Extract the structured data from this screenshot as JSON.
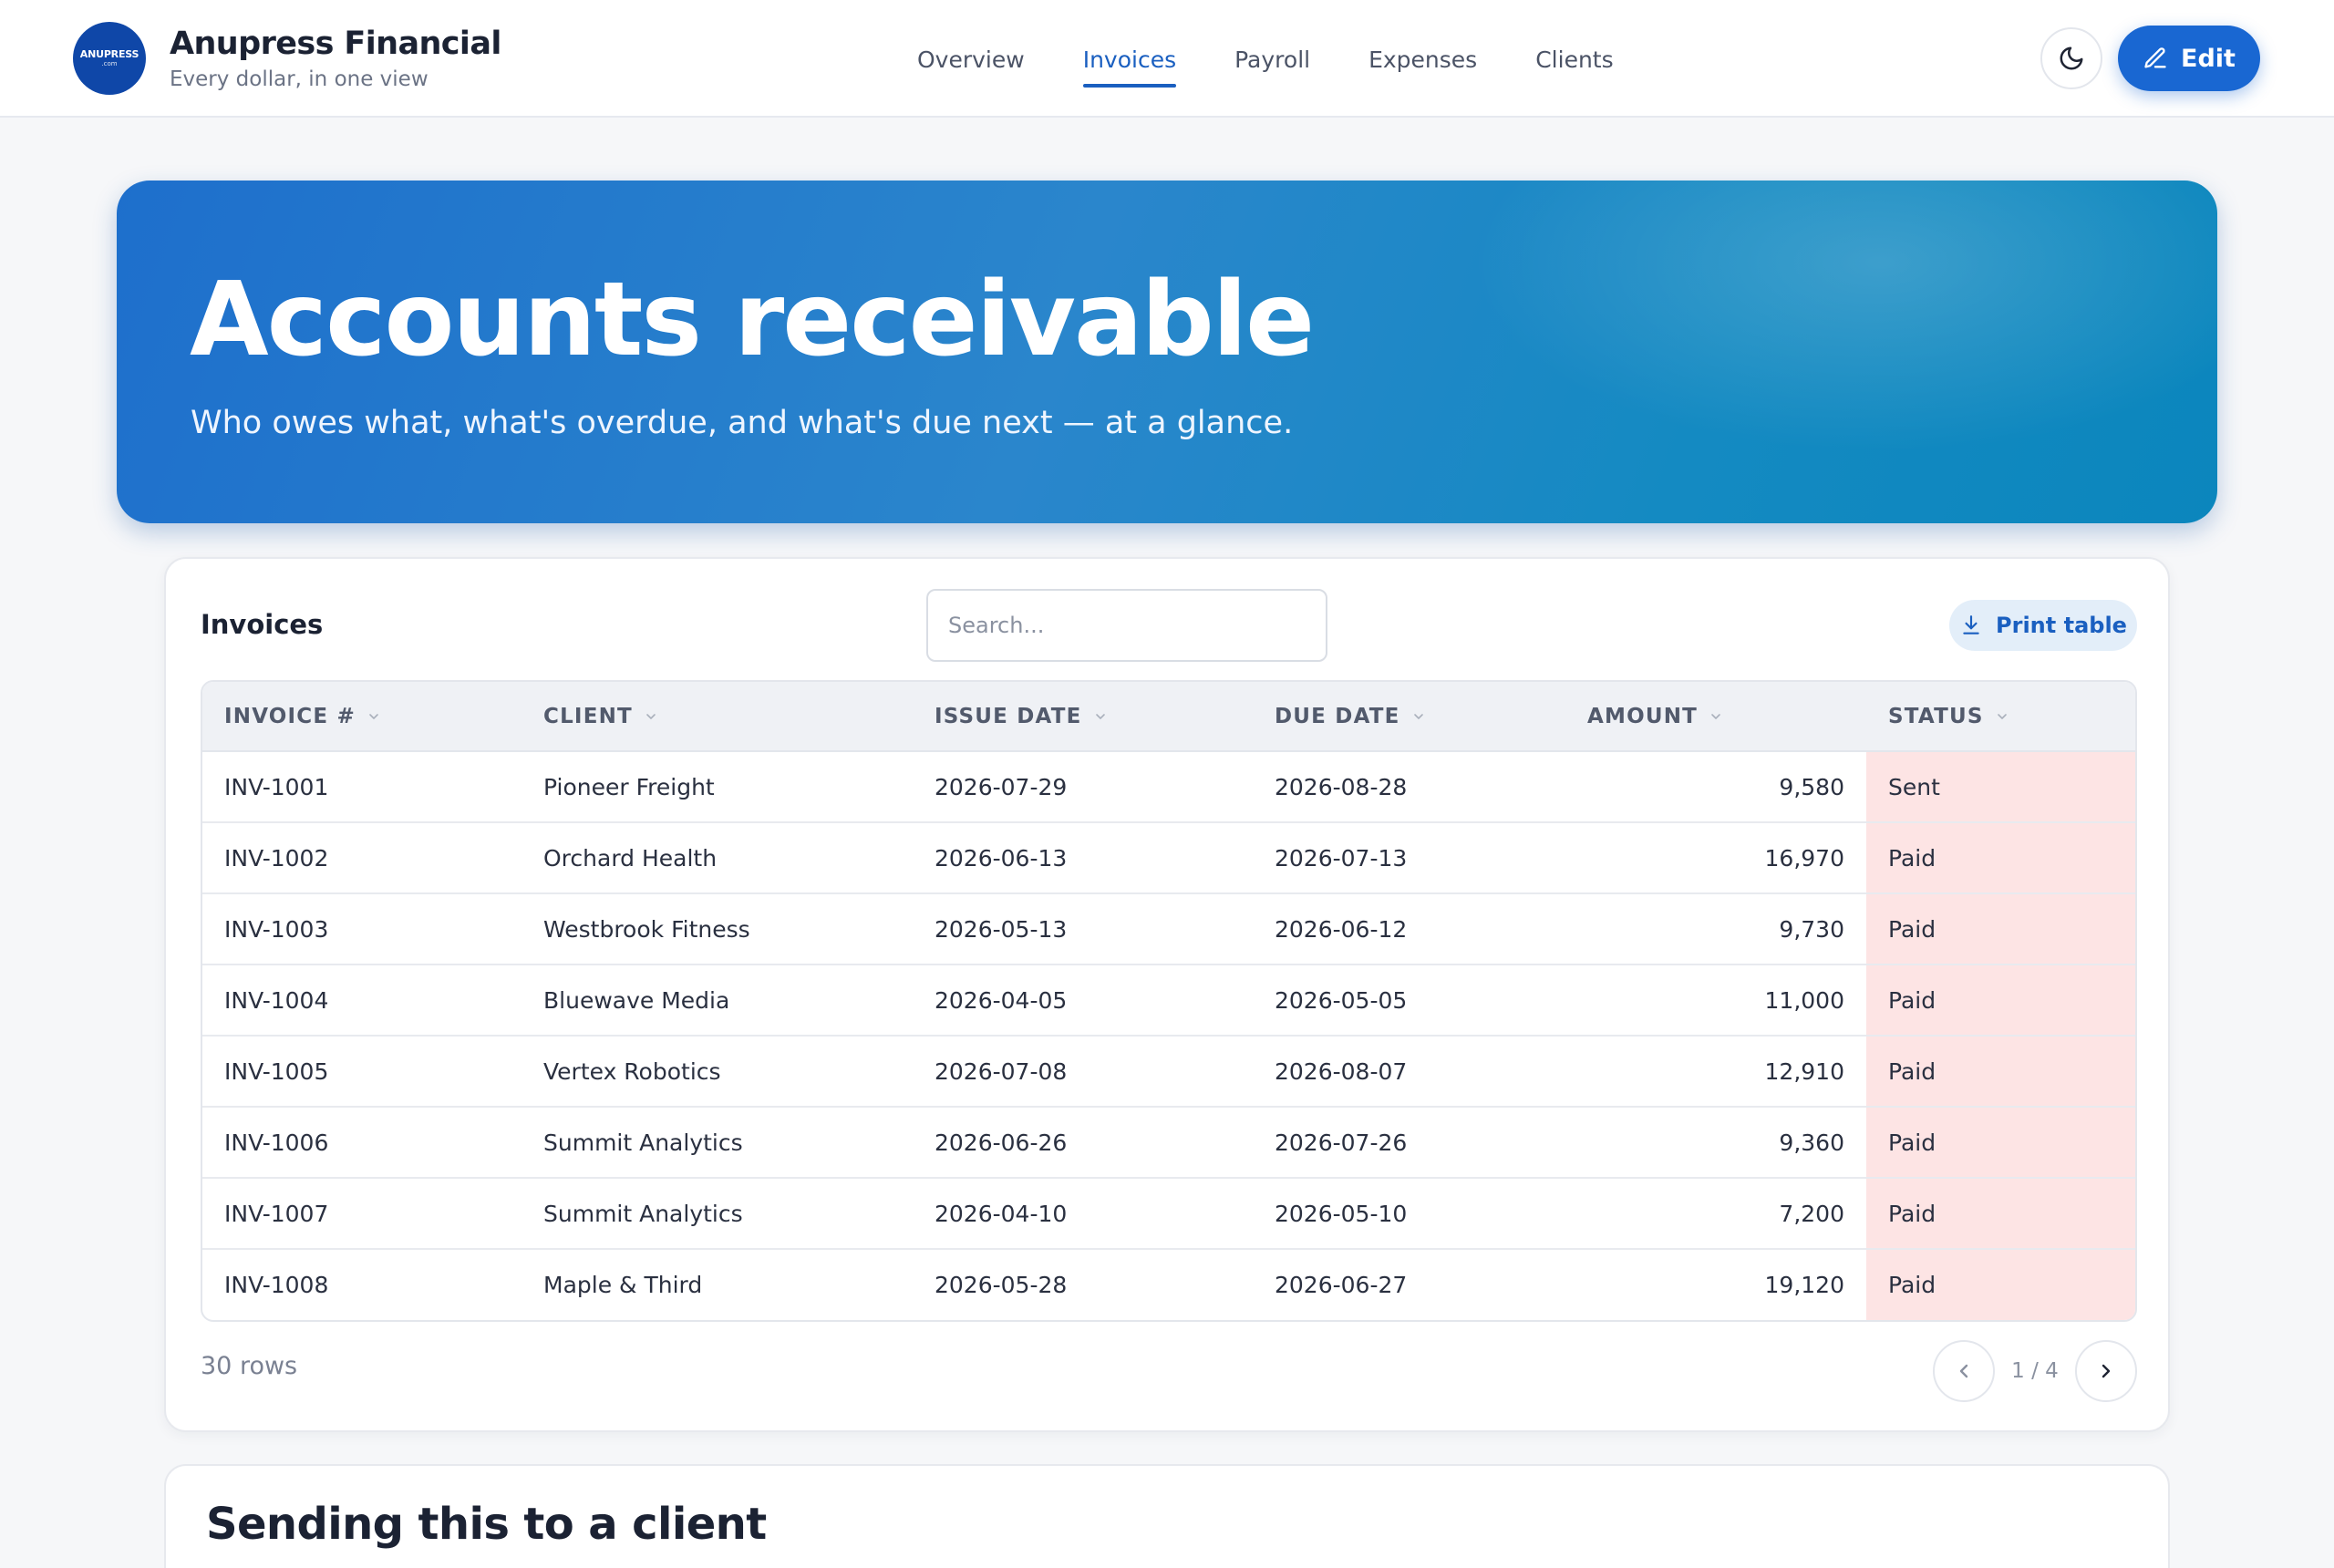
{
  "brand": {
    "logo_text": "ANUPRESS",
    "logo_sub": ".com",
    "name": "Anupress Financial",
    "tagline": "Every dollar, in one view"
  },
  "nav": {
    "items": [
      "Overview",
      "Invoices",
      "Payroll",
      "Expenses",
      "Clients"
    ],
    "active": "Invoices"
  },
  "header": {
    "theme_icon": "moon-icon",
    "edit_label": "Edit",
    "edit_icon": "pencil-icon"
  },
  "hero": {
    "title": "Accounts receivable",
    "subtitle": "Who owes what, what's overdue, and what's due next — at a glance."
  },
  "invoices": {
    "title": "Invoices",
    "search_placeholder": "Search...",
    "print_label": "Print table",
    "print_icon": "download-icon",
    "columns": [
      "INVOICE #",
      "CLIENT",
      "ISSUE DATE",
      "DUE DATE",
      "AMOUNT",
      "STATUS"
    ],
    "rows": [
      [
        "INV-1001",
        "Pioneer Freight",
        "2026-07-29",
        "2026-08-28",
        "9,580",
        "Sent"
      ],
      [
        "INV-1002",
        "Orchard Health",
        "2026-06-13",
        "2026-07-13",
        "16,970",
        "Paid"
      ],
      [
        "INV-1003",
        "Westbrook Fitness",
        "2026-05-13",
        "2026-06-12",
        "9,730",
        "Paid"
      ],
      [
        "INV-1004",
        "Bluewave Media",
        "2026-04-05",
        "2026-05-05",
        "11,000",
        "Paid"
      ],
      [
        "INV-1005",
        "Vertex Robotics",
        "2026-07-08",
        "2026-08-07",
        "12,910",
        "Paid"
      ],
      [
        "INV-1006",
        "Summit Analytics",
        "2026-06-26",
        "2026-07-26",
        "9,360",
        "Paid"
      ],
      [
        "INV-1007",
        "Summit Analytics",
        "2026-04-10",
        "2026-05-10",
        "7,200",
        "Paid"
      ],
      [
        "INV-1008",
        "Maple & Third",
        "2026-05-28",
        "2026-06-27",
        "19,120",
        "Paid"
      ]
    ],
    "row_count": "30 rows",
    "page_label": "1 / 4"
  },
  "section2": {
    "title": "Sending this to a client"
  },
  "colors": {
    "accent": "#1967d2",
    "hero_start": "#1e6fcc",
    "hero_end": "#0b86bd",
    "status_cell": "#fde4e4"
  }
}
